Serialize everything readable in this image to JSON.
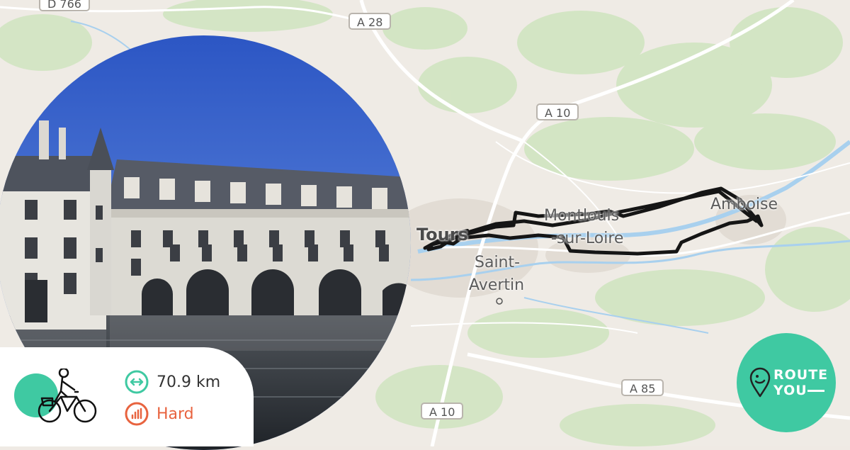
{
  "map": {
    "road_labels": [
      "D 766",
      "A 28",
      "A 10",
      "A 85",
      "A 10"
    ],
    "place_labels": [
      "Tours",
      "Saint-",
      "Avertin",
      "Montlouis",
      "-sur-Loire",
      "Amboise"
    ]
  },
  "stats": {
    "distance": "70.9 km",
    "difficulty": "Hard",
    "activity": "cycling",
    "accent_color": "#3fc9a2",
    "difficulty_color": "#e8633f"
  },
  "logo": {
    "line1": "ROUTE",
    "line2": "YOU"
  }
}
